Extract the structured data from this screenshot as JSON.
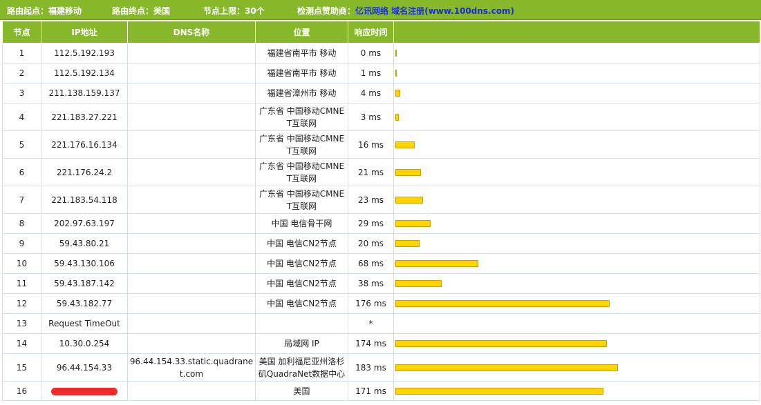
{
  "topbar": {
    "start_label": "路由起点：福建移动",
    "end_label": "路由终点：美国",
    "limit_label": "节点上限：30个",
    "sponsor_label": "检测点赞助商：",
    "sponsor_link": "亿讯网络 域名注册",
    "sponsor_url": "(www.100dns.com)"
  },
  "columns": [
    "节点",
    "IP地址",
    "DNS名称",
    "位置",
    "响应时间",
    ""
  ],
  "rows": [
    {
      "node": "1",
      "ip": "112.5.192.193",
      "dns": "",
      "location": "福建省南平市 移动",
      "time": "0 ms",
      "ms": 0
    },
    {
      "node": "2",
      "ip": "112.5.192.134",
      "dns": "",
      "location": "福建省南平市 移动",
      "time": "1 ms",
      "ms": 1
    },
    {
      "node": "3",
      "ip": "211.138.159.137",
      "dns": "",
      "location": "福建省漳州市 移动",
      "time": "4 ms",
      "ms": 4
    },
    {
      "node": "4",
      "ip": "221.183.27.221",
      "dns": "",
      "location": "广东省 中国移动CMNET互联网",
      "time": "3 ms",
      "ms": 3
    },
    {
      "node": "5",
      "ip": "221.176.16.134",
      "dns": "",
      "location": "广东省 中国移动CMNET互联网",
      "time": "16 ms",
      "ms": 16
    },
    {
      "node": "6",
      "ip": "221.176.24.2",
      "dns": "",
      "location": "广东省 中国移动CMNET互联网",
      "time": "21 ms",
      "ms": 21
    },
    {
      "node": "7",
      "ip": "221.183.54.118",
      "dns": "",
      "location": "广东省 中国移动CMNET互联网",
      "time": "23 ms",
      "ms": 23
    },
    {
      "node": "8",
      "ip": "202.97.63.197",
      "dns": "",
      "location": "中国 电信骨干网",
      "time": "29 ms",
      "ms": 29
    },
    {
      "node": "9",
      "ip": "59.43.80.21",
      "dns": "",
      "location": "中国 电信CN2节点",
      "time": "20 ms",
      "ms": 20
    },
    {
      "node": "10",
      "ip": "59.43.130.106",
      "dns": "",
      "location": "中国 电信CN2节点",
      "time": "68 ms",
      "ms": 68
    },
    {
      "node": "11",
      "ip": "59.43.187.142",
      "dns": "",
      "location": "中国 电信CN2节点",
      "time": "38 ms",
      "ms": 38
    },
    {
      "node": "12",
      "ip": "59.43.182.77",
      "dns": "",
      "location": "中国 电信CN2节点",
      "time": "176 ms",
      "ms": 176
    },
    {
      "node": "13",
      "ip": "Request TimeOut",
      "dns": "",
      "location": "",
      "time": "*",
      "ms": null
    },
    {
      "node": "14",
      "ip": "10.30.0.254",
      "dns": "",
      "location": "局域网 IP",
      "time": "174 ms",
      "ms": 174
    },
    {
      "node": "15",
      "ip": "96.44.154.33",
      "dns": "96.44.154.33.static.quadranet.com",
      "location": "美国 加利福尼亚州洛杉矶QuadraNet数据中心",
      "time": "183 ms",
      "ms": 183
    },
    {
      "node": "16",
      "ip": "",
      "ip_redacted": true,
      "dns": "",
      "location": "美国",
      "time": "171 ms",
      "ms": 171
    }
  ],
  "bar_color": "#ffd400",
  "header_color": "#86b82a",
  "sponsor_link_color": "#1a2fd6"
}
